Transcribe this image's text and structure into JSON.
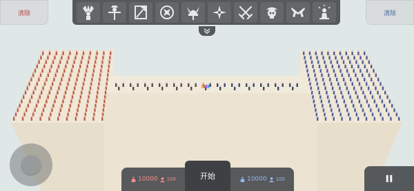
{
  "toolbar": {
    "clear_left_label": "清除",
    "clear_right_label": "清除",
    "units": [
      {
        "icon": "tribal-chief-icon"
      },
      {
        "icon": "scarecrow-icon"
      },
      {
        "icon": "archer-target-icon"
      },
      {
        "icon": "shield-icon"
      },
      {
        "icon": "viking-helmet-icon"
      },
      {
        "icon": "ninja-shuriken-icon"
      },
      {
        "icon": "crossed-swords-icon"
      },
      {
        "icon": "pirate-skull-icon"
      },
      {
        "icon": "crossed-pistols-icon"
      },
      {
        "icon": "beacon-figure-icon"
      }
    ],
    "expand_icon": "double-chevron-down-icon"
  },
  "bottom_bar": {
    "start_label": "开始",
    "red_team": {
      "gold": "10000",
      "units": "100",
      "color": "#e06a6a"
    },
    "blue_team": {
      "gold": "10000",
      "units": "100",
      "color": "#4a6ea8"
    },
    "pause_icon": "pause-icon"
  },
  "colors": {
    "background": "#dfe8e6",
    "terrain_top": "#efe6d6",
    "terrain_side": "#e6dcc8",
    "red_army": "#b8614a",
    "blue_army": "#4f5f92",
    "panel": "#56595c"
  }
}
